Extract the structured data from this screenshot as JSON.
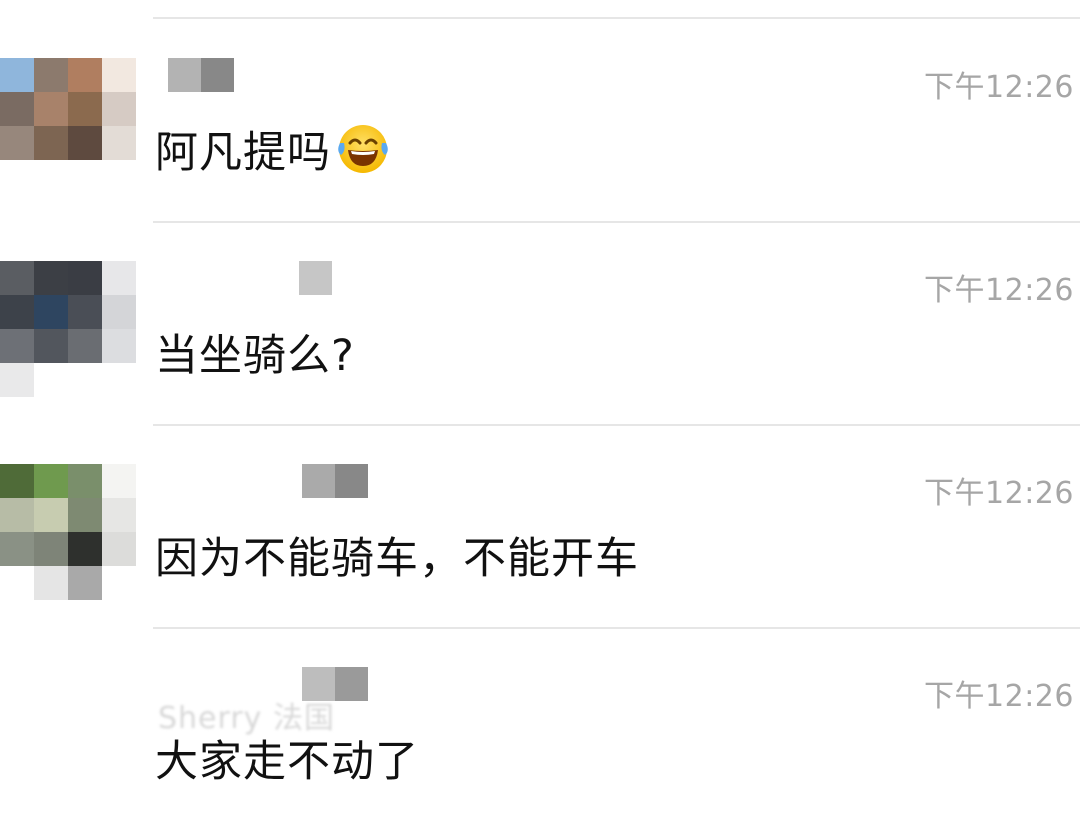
{
  "messages": [
    {
      "time": "下午12:26",
      "text": "阿凡提吗",
      "emoji": "face-with-tears-of-joy-icon",
      "avatar_mosaic": [
        "#8fb6dc",
        "#8c7a6d",
        "#b07e60",
        "#f2e8e0",
        "#7a6b62",
        "#a8826a",
        "#8b6a4e",
        "#d6cbc4",
        "#97877c",
        "#7d6552",
        "#5e4a3f",
        "#e3dcd6",
        "#ffffff",
        "#ffffff",
        "#ffffff",
        "#ffffff"
      ],
      "name_mosaic": [
        "#b3b3b3",
        "#888888"
      ]
    },
    {
      "time": "下午12:26",
      "text": "当坐骑么?",
      "avatar_mosaic": [
        "#5a5d62",
        "#3c3f45",
        "#3a3d44",
        "#e7e7e9",
        "#3d424a",
        "#2e4560",
        "#4a4e56",
        "#d4d5d8",
        "#6d7076",
        "#52565d",
        "#6a6d72",
        "#dcdde0",
        "#e9e9ea",
        "#ffffff",
        "#ffffff",
        "#ffffff"
      ],
      "name_mosaic": [
        "#ffffff",
        "#c6c6c6"
      ]
    },
    {
      "time": "下午12:26",
      "text": "因为不能骑车，不能开车",
      "avatar_mosaic": [
        "#4f6b38",
        "#6f9a4e",
        "#7a8f6b",
        "#f4f4f2",
        "#b7bca6",
        "#c7ccb0",
        "#7e8a72",
        "#e6e6e4",
        "#8a9185",
        "#7e8478",
        "#2e302d",
        "#dcdcda",
        "#ffffff",
        "#e5e5e5",
        "#a9a9a9",
        "#ffffff"
      ],
      "name_mosaic": [
        "#aaaaaa",
        "#888888"
      ]
    },
    {
      "time": "下午12:26",
      "text": "大家走不动了",
      "avatar_mosaic": [],
      "name_mosaic": [
        "#bdbdbd",
        "#9a9a9a"
      ],
      "name_ghost": "Sherry 法国"
    }
  ]
}
